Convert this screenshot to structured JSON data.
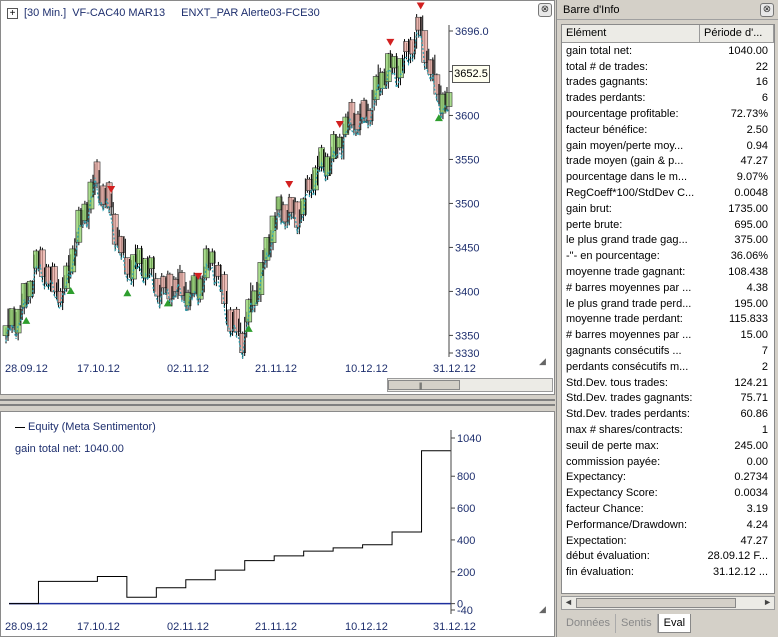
{
  "chart_header": {
    "interval": "[30 Min.]",
    "symbol": "VF-CAC40 MAR13",
    "study": "ENXT_PAR Alerte03-FCE30",
    "expand_glyph": "+"
  },
  "price_chart": {
    "price_tag": "3652.5",
    "y_ticks": [
      "3696.0",
      "3650",
      "3600",
      "3550",
      "3500",
      "3450",
      "3400",
      "3350",
      "3330"
    ],
    "x_ticks": [
      "28.09.12",
      "17.10.12",
      "02.11.12",
      "21.11.12",
      "10.12.12",
      "31.12.12"
    ]
  },
  "equity_panel": {
    "title": "Equity (Meta Sentimentor)",
    "value_label": "gain total net: 1040.00",
    "y_ticks": [
      "1040",
      "800",
      "600",
      "400",
      "200",
      "0",
      "-40"
    ],
    "x_ticks": [
      "28.09.12",
      "17.10.12",
      "02.11.12",
      "21.11.12",
      "10.12.12",
      "31.12.12"
    ]
  },
  "chart_data": [
    {
      "type": "line",
      "series": [
        {
          "x": [
            "28.09.12",
            "05.10.12",
            "12.10.12",
            "17.10.12",
            "24.10.12",
            "02.11.12",
            "09.11.12",
            "16.11.12",
            "21.11.12",
            "28.11.12",
            "04.12.12",
            "10.12.12",
            "17.12.12",
            "21.12.12",
            "27.12.12",
            "31.12.12"
          ],
          "values": [
            3345,
            3425,
            3405,
            3535,
            3440,
            3415,
            3395,
            3430,
            3340,
            3475,
            3500,
            3560,
            3600,
            3650,
            3690,
            3600
          ]
        }
      ],
      "ylim": [
        3330,
        3696
      ],
      "grid": false
    },
    {
      "type": "line",
      "series": [
        {
          "name": "Equity (Meta Sentimentor)",
          "x": [
            "28.09.12",
            "05.10.12",
            "12.10.12",
            "17.10.12",
            "24.10.12",
            "02.11.12",
            "09.11.12",
            "16.11.12",
            "21.11.12",
            "28.11.12",
            "04.12.12",
            "10.12.12",
            "17.12.12",
            "21.12.12",
            "27.12.12",
            "31.12.12"
          ],
          "values": [
            0,
            140,
            140,
            170,
            40,
            100,
            150,
            210,
            270,
            300,
            330,
            350,
            370,
            450,
            960,
            1040
          ]
        }
      ],
      "ylim": [
        -40,
        1040
      ],
      "grid": false
    }
  ],
  "info_panel": {
    "title": "Barre d'Info",
    "close_glyph": "⊗",
    "columns": [
      "Elément",
      "Période d'..."
    ],
    "rows": [
      {
        "k": "gain total net:",
        "v": "1040.00"
      },
      {
        "k": "total # de trades:",
        "v": "22"
      },
      {
        "k": "trades gagnants:",
        "v": "16"
      },
      {
        "k": "trades perdants:",
        "v": "6"
      },
      {
        "k": "pourcentage profitable:",
        "v": "72.73%"
      },
      {
        "k": "facteur bénéfice:",
        "v": "2.50"
      },
      {
        "k": "gain moyen/perte moy...",
        "v": "0.94"
      },
      {
        "k": "trade moyen (gain & p...",
        "v": "47.27"
      },
      {
        "k": "pourcentage dans le m...",
        "v": "9.07%"
      },
      {
        "k": "RegCoeff*100/StdDev C...",
        "v": "0.0048"
      },
      {
        "k": "gain brut:",
        "v": "1735.00"
      },
      {
        "k": "perte brute:",
        "v": "695.00"
      },
      {
        "k": "le plus grand trade gag...",
        "v": "375.00"
      },
      {
        "k": "  -\"- en pourcentage:",
        "v": "36.06%"
      },
      {
        "k": "moyenne trade gagnant:",
        "v": "108.438"
      },
      {
        "k": "# barres moyennes par ...",
        "v": "4.38"
      },
      {
        "k": "le plus grand trade perd...",
        "v": "195.00"
      },
      {
        "k": "moyenne trade perdant:",
        "v": "115.833"
      },
      {
        "k": "# barres moyennes par ...",
        "v": "15.00"
      },
      {
        "k": "gagnants consécutifs ...",
        "v": "7"
      },
      {
        "k": "perdants consécutifs m...",
        "v": "2"
      },
      {
        "k": "Std.Dev. tous trades:",
        "v": "124.21"
      },
      {
        "k": "Std.Dev. trades gagnants:",
        "v": "75.71"
      },
      {
        "k": "Std.Dev. trades perdants:",
        "v": "60.86"
      },
      {
        "k": "max # shares/contracts:",
        "v": "1"
      },
      {
        "k": "seuil de perte max:",
        "v": "245.00"
      },
      {
        "k": "commission payée:",
        "v": "0.00"
      },
      {
        "k": "Expectancy:",
        "v": "0.2734"
      },
      {
        "k": "Expectancy Score:",
        "v": "0.0034"
      },
      {
        "k": "facteur Chance:",
        "v": "3.19"
      },
      {
        "k": "Performance/Drawdown:",
        "v": "4.24"
      },
      {
        "k": "Expectation:",
        "v": "47.27"
      },
      {
        "k": "début évaluation:",
        "v": "28.09.12 F..."
      },
      {
        "k": "fin évaluation:",
        "v": "31.12.12 ..."
      }
    ],
    "tabs": [
      "Données",
      "Sentis",
      "Eval"
    ],
    "active_tab": "Eval"
  },
  "colors": {
    "axis_text": "#1e2f6e",
    "candle_up": "#8fd36a",
    "candle_down": "#e8a8a0",
    "trade_buy": "#2e9e2e",
    "trade_sell": "#d22020",
    "equity_line": "#000000",
    "zero_line": "#1e2f9e"
  }
}
